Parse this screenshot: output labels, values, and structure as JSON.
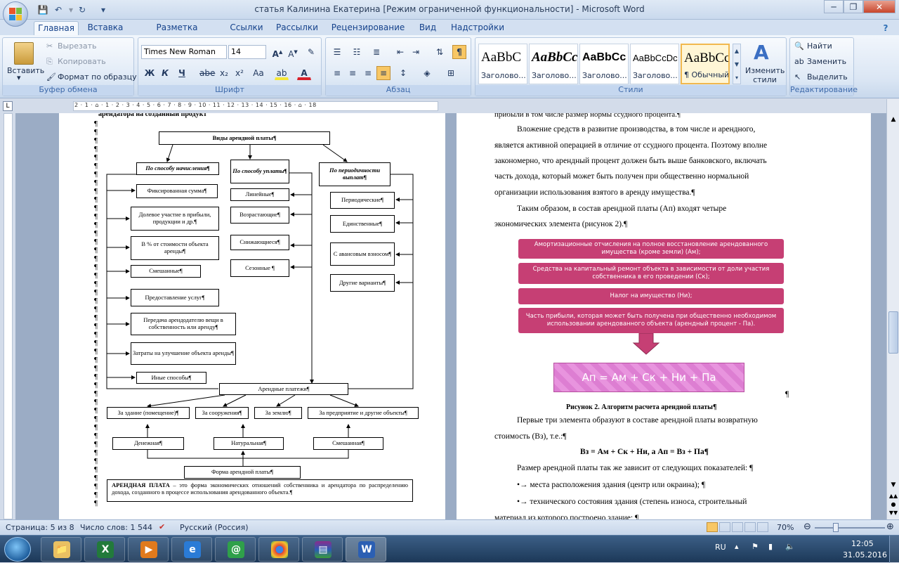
{
  "window": {
    "title": "статья Калинина Екатерина [Режим ограниченной функциональности] - Microsoft Word"
  },
  "tabs": [
    "Главная",
    "Вставка",
    "Разметка страницы",
    "Ссылки",
    "Рассылки",
    "Рецензирование",
    "Вид",
    "Надстройки"
  ],
  "ribbon": {
    "clipboard": {
      "paste": "Вставить",
      "cut": "Вырезать",
      "copy": "Копировать",
      "format_painter": "Формат по образцу",
      "label": "Буфер обмена"
    },
    "font": {
      "name": "Times New Roman",
      "size": "14",
      "label": "Шрифт",
      "bold": "Ж",
      "italic": "К",
      "underline": "Ч",
      "strike": "abe",
      "sub": "x₂",
      "sup": "x²",
      "case": "Aa"
    },
    "paragraph": {
      "label": "Абзац"
    },
    "styles": {
      "label": "Стили",
      "items": [
        {
          "preview": "AaBbC",
          "name": "Заголово..."
        },
        {
          "preview": "AaBbCc",
          "name": "Заголово..."
        },
        {
          "preview": "AaBbCc",
          "name": "Заголово..."
        },
        {
          "preview": "AaBbCcDc",
          "name": "Заголово..."
        },
        {
          "preview": "AaBbCcI",
          "name": "¶ Обычный"
        }
      ],
      "change": "Изменить стили"
    },
    "editing": {
      "find": "Найти",
      "replace": "Заменить",
      "select": "Выделить",
      "label": "Редактирование"
    }
  },
  "ruler": {
    "marks": "2 · 1 · ⌂ · 1 · 2 · 3 · 4 · 5 · 6 · 7 · 8 · 9 · 10 · 11 · 12 · 13 · 14 · 15 · 16 · ⌂ · 18"
  },
  "left_page": {
    "top_line": "арендатора на созданный продукт",
    "diagram": {
      "title": "Виды арендной платы¶",
      "col_headers": [
        "По способу начисления¶",
        "По способу уплаты¶",
        "По периодичности выплат¶"
      ],
      "left_items": [
        "Фиксированная сумма¶",
        "Долевое участие в прибыли, продукции и др.¶",
        "В % от стоимости объекта аренды¶",
        "Смешанные¶",
        "Предоставление услуг¶",
        "Передача арендодателю вещи в собственность или аренду¶",
        "Затраты на улучшение объекта аренды¶",
        "Иные способы¶"
      ],
      "middle_items": [
        "Линейные¶",
        "Возрастающие¶",
        "Снижающиеся¶",
        "Сезонные ¶"
      ],
      "right_items": [
        "Периодические¶",
        "Единственные¶",
        "С авансовым взносом¶",
        "Другие варианты¶"
      ],
      "payments": "Арендные платежи¶",
      "objects": [
        "За здание (помещение)¶",
        "За сооружения¶",
        "За землю¶",
        "За предприятие и другие объекты¶"
      ],
      "forms": [
        "Денежная¶",
        "Натуральная¶",
        "Смешанная¶"
      ],
      "form_title": "Форма арендной платы¶",
      "definition_bold": "АРЕНДНАЯ ПЛАТА",
      "definition": " – это форма экономических отношений собственника и арендатора по распределению дохода, созданного в процессе использования арендованного объекта.¶"
    }
  },
  "right_page": {
    "top_line": "прибыли в том числе размер нормы ссудного процента.¶",
    "para1": [
      "Вложение средств в развитие производства, в том числе и арендного,",
      "является активной операцией в отличие от ссудного процента. Поэтому вполне",
      "закономерно, что арендный процент должен быть выше банковского, включать",
      "часть дохода, который может быть получен при общественно нормальной",
      "организации использования взятого в аренду имущества.¶"
    ],
    "para2": [
      "Таким образом, в состав арендной платы (Ап) входят четыре",
      "экономических элемента (рисунок 2).¶"
    ],
    "elements": [
      "Амортизационные отчисления на полное восстановление арендованного имущества (кроме земли) (Ам);",
      "Средства на капитальный ремонт объекта в зависимости от доли участия собственника в его проведении (Ск);",
      "Налог на имущество (Ни);",
      "Часть прибыли, которая может быть получена при общественно необходимом использовании арендованного объекта (арендный процент - Па)."
    ],
    "formula_box": "Ап = Ам + Ск + Ни + Па",
    "caption": "Рисунок 2. Алгоритм расчета арендной платы¶",
    "para3": [
      "Первые три элемента образуют в составе арендной платы возвратную",
      "стоимость (Вз), т.е.:¶"
    ],
    "formula2": "Вз = Ам + Ск + Ни, а Ап = Вз + Па¶",
    "para4": "Размер арендной платы так же зависит от следующих показателей: ¶",
    "bullets": [
      "места расположения здания (центр или окраина); ¶",
      "технического состояния здания (степень износа, строительный"
    ],
    "last_line": "материал из которого построено здание; ¶"
  },
  "status": {
    "page": "Страница: 5 из 8",
    "words": "Число слов: 1 544",
    "language": "Русский (Россия)",
    "zoom": "70%"
  },
  "taskbar": {
    "lang": "RU",
    "time": "12:05",
    "date": "31.05.2016"
  }
}
